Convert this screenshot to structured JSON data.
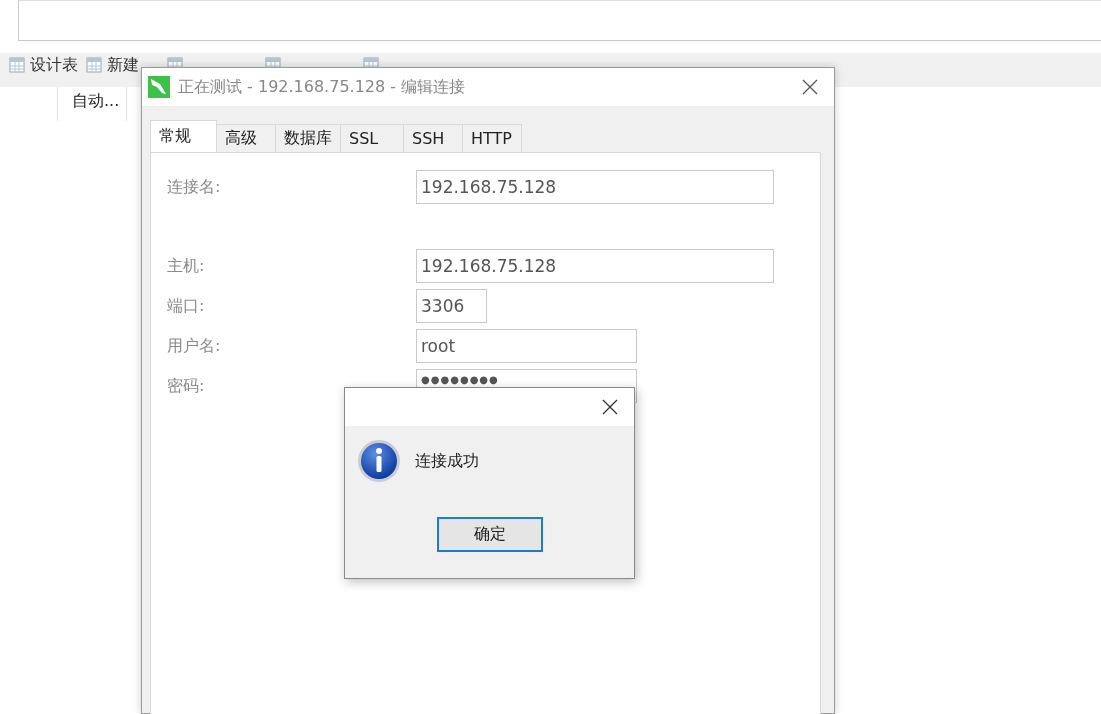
{
  "toolbar": [
    {
      "kind": "labeled",
      "label": "设计表"
    },
    {
      "kind": "labeled",
      "label": "新建"
    },
    {
      "kind": "covered"
    },
    {
      "kind": "covered"
    },
    {
      "kind": "covered"
    }
  ],
  "table": {
    "columns": [
      "自动..."
    ]
  },
  "dialog": {
    "title": "正在测试 - 192.168.75.128 - 编辑连接",
    "tabs": [
      {
        "label": "常规",
        "selected": true
      },
      {
        "label": "高级",
        "selected": false
      },
      {
        "label": "数据库",
        "selected": false
      },
      {
        "label": "SSL",
        "selected": false
      },
      {
        "label": "SSH",
        "selected": false
      },
      {
        "label": "HTTP",
        "selected": false
      }
    ],
    "fields": [
      {
        "label": "连接名:",
        "value": "192.168.75.128"
      },
      {
        "label": "主机:",
        "value": "192.168.75.128"
      },
      {
        "label": "端口:",
        "value": "3306"
      },
      {
        "label": "用户名:",
        "value": "root"
      },
      {
        "label": "密码:",
        "value": "●●●●●●●●"
      }
    ]
  },
  "message_box": {
    "text": "连接成功",
    "button": "确定"
  }
}
